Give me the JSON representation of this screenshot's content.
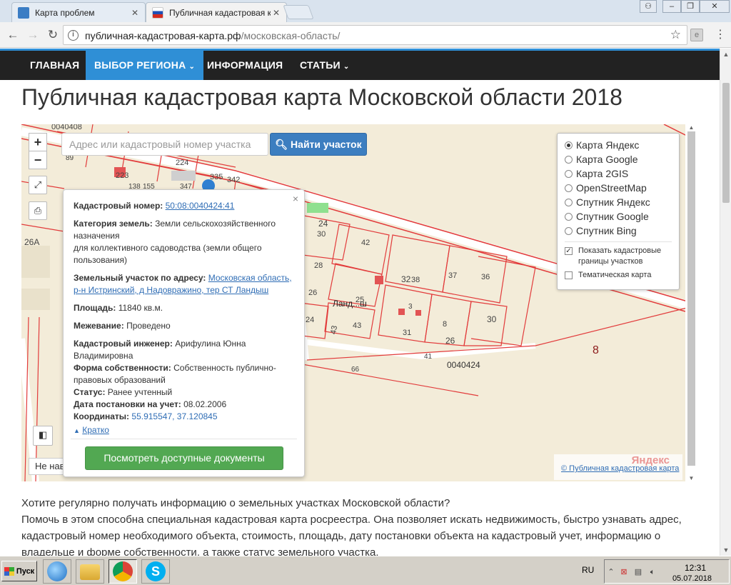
{
  "browser": {
    "tabs": [
      {
        "title": "Карта проблем",
        "icon": "map-problems-icon"
      },
      {
        "title": "Публичная кадастровая ка",
        "icon": "russia-flag-icon"
      }
    ],
    "url_host": "публичная-кадастровая-карта.рф",
    "url_path": "/московская-область/"
  },
  "site_nav": {
    "items": [
      "ГЛАВНАЯ",
      "ВЫБОР РЕГИОНА",
      "ИНФОРМАЦИЯ",
      "СТАТЬИ"
    ]
  },
  "page": {
    "title": "Публичная кадастровая карта Московской области 2018"
  },
  "map": {
    "search_placeholder": "Адрес или кадастровый номер участка",
    "search_button": "Найти участок",
    "layers": [
      "Карта Яндекс",
      "Карта Google",
      "Карта 2GIS",
      "OpenStreetMap",
      "Спутник Яндекс",
      "Спутник Google",
      "Спутник Bing"
    ],
    "selected_layer": "Карта Яндекс",
    "toggle_cadastral": "Показать кадастровые границы участков",
    "toggle_cadastral_checked": true,
    "toggle_thematic": "Тематическая карта",
    "toggle_thematic_checked": false,
    "bottom_left_control": "Не нав",
    "attribution_brand": "Яндекс",
    "attribution_link": "© Публичная кадастровая карта",
    "labels": [
      "0040408",
      "89",
      "223",
      "224",
      "335",
      "342",
      "138",
      "155",
      "347",
      "26A",
      "24",
      "30",
      "42",
      "28",
      "32",
      "38",
      "37",
      "36",
      "26",
      "25",
      "Ланд...ш",
      "24",
      "43",
      "43",
      "3",
      "31",
      "8",
      "26",
      "30",
      "8",
      "41",
      "0040424",
      "66"
    ]
  },
  "popup": {
    "cad_label": "Кадастровый номер:",
    "cad_value": "50:08:0040424:41",
    "category_label": "Категория земель:",
    "category_value": "Земли сельскохозяйственного назначения",
    "category_value2": "для коллективного садоводства (земли общего пользования)",
    "address_label": "Земельный участок по адресу:",
    "address_value": "Московская область, р-н Истринский, д Надовражино, тер СТ Ландыш",
    "area_label": "Площадь:",
    "area_value": "11840 кв.м.",
    "survey_label": "Межевание:",
    "survey_value": "Проведено",
    "engineer_label": "Кадастровый инженер:",
    "engineer_value": "Арифулина Юнна Владимировна",
    "ownership_label": "Форма собственности:",
    "ownership_value": "Собственность публично-правовых образований",
    "status_label": "Статус:",
    "status_value": "Ранее учтенный",
    "date_label": "Дата постановки на учет:",
    "date_value": "08.02.2006",
    "coords_label": "Координаты:",
    "coords_value": "55.915547, 37.120845",
    "brief_link": "Кратко",
    "docs_button": "Посмотреть доступные документы",
    "close_glyph": "×"
  },
  "article": {
    "line1": "Хотите регулярно получать информацию о земельных участках Московской области?",
    "line2": "Помочь в этом способна специальная кадастровая карта росреестра. Она позволяет искать недвижимость, быстро узнавать адрес, кадастровый номер необходимого объекта, стоимость, площадь, дату постановки объекта на кадастровый учет, информацию о владельце и форме собственности, а также статус земельного участка."
  },
  "taskbar": {
    "start_label": "Пуск",
    "lang": "RU",
    "time": "12:31",
    "date": "05.07.2018",
    "apps": [
      "internet-explorer-icon",
      "file-explorer-icon",
      "chrome-icon",
      "skype-icon"
    ]
  },
  "colors": {
    "nav_bg": "#222222",
    "nav_active": "#2f8fd6",
    "search_btn": "#3c7ec0",
    "docs_btn": "#52a852",
    "parcel_line": "#e23b3b",
    "map_bg": "#f3ecd9"
  }
}
